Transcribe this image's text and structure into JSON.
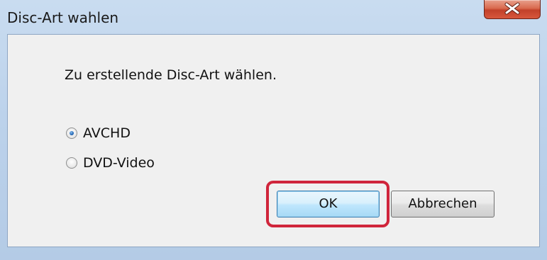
{
  "window": {
    "title": "Disc-Art wahlen",
    "close_icon": "close-icon"
  },
  "dialog": {
    "prompt": "Zu erstellende Disc-Art wählen.",
    "options": [
      {
        "label": "AVCHD",
        "selected": true
      },
      {
        "label": "DVD-Video",
        "selected": false
      }
    ],
    "buttons": {
      "ok_label": "OK",
      "cancel_label": "Abbrechen"
    }
  },
  "colors": {
    "highlight": "#d0253b",
    "close_button": "#c2412a",
    "ok_button_border": "#3c7fb1"
  }
}
